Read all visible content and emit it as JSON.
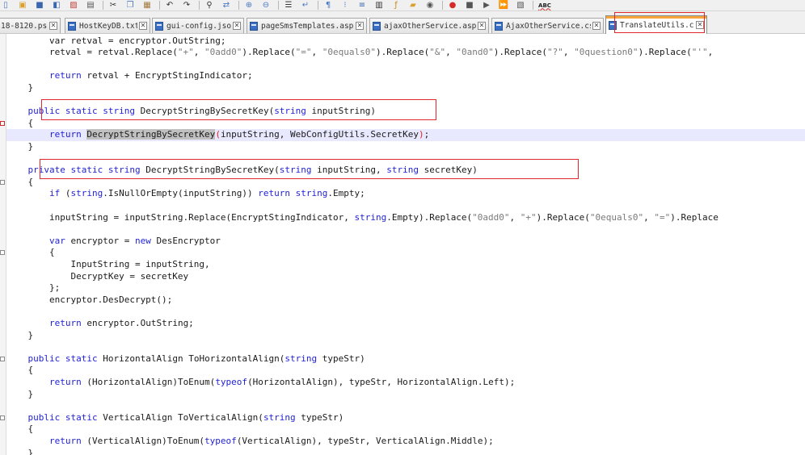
{
  "toolbar": {
    "icons": [
      "new-file-icon",
      "open-icon",
      "save-icon",
      "save-all-icon",
      "close-file-icon",
      "print-icon",
      "cut-icon",
      "copy-icon",
      "paste-icon",
      "undo-icon",
      "redo-icon",
      "find-icon",
      "replace-icon",
      "zoom-in-icon",
      "zoom-out-icon",
      "sync-scroll-icon",
      "word-wrap-icon",
      "show-all-chars-icon",
      "indent-guide-icon",
      "lang-icon",
      "doc-map-icon",
      "function-list-icon",
      "folder-workspace-icon",
      "monitor-icon",
      "record-macro-icon",
      "stop-macro-icon",
      "play-macro-icon",
      "run-macro-multiple-icon",
      "save-macro-icon",
      "spellcheck-icon"
    ],
    "spellcheck_label": "ABC"
  },
  "tabs": [
    {
      "label": "18-8120.ps1",
      "close": "✕"
    },
    {
      "label": "HostKeyDB.txt",
      "close": "✕"
    },
    {
      "label": "gui-config.json",
      "close": "✕"
    },
    {
      "label": "pageSmsTemplates.aspx",
      "close": "✕"
    },
    {
      "label": "ajaxOtherService.aspx",
      "close": "✕"
    },
    {
      "label": "AjaxOtherService.cs",
      "close": "✕"
    },
    {
      "label": "TranslateUtils.cs",
      "close": "✕",
      "active": true
    }
  ],
  "colors": {
    "keyword": "#1f1fd6",
    "string": "#7a7a7a",
    "annotation": "#e0282d",
    "active_tab_accent": "#f5a53c",
    "current_line": "#e8e8ff"
  },
  "code": [
    [
      {
        "t": "        var retval = encryptor.OutString;"
      }
    ],
    [
      {
        "t": "        retval = retval.Replace("
      },
      {
        "t": "\"+\"",
        "c": "str"
      },
      {
        "t": ", "
      },
      {
        "t": "\"0add0\"",
        "c": "str"
      },
      {
        "t": ").Replace("
      },
      {
        "t": "\"=\"",
        "c": "str"
      },
      {
        "t": ", "
      },
      {
        "t": "\"0equals0\"",
        "c": "str"
      },
      {
        "t": ").Replace("
      },
      {
        "t": "\"&\"",
        "c": "str"
      },
      {
        "t": ", "
      },
      {
        "t": "\"0and0\"",
        "c": "str"
      },
      {
        "t": ").Replace("
      },
      {
        "t": "\"?\"",
        "c": "str"
      },
      {
        "t": ", "
      },
      {
        "t": "\"0question0\"",
        "c": "str"
      },
      {
        "t": ").Replace("
      },
      {
        "t": "\"'\"",
        "c": "str"
      },
      {
        "t": ","
      }
    ],
    [
      {
        "t": ""
      }
    ],
    [
      {
        "t": "        "
      },
      {
        "t": "return",
        "c": "kw"
      },
      {
        "t": " retval + EncryptStingIndicator;"
      }
    ],
    [
      {
        "t": "    }"
      }
    ],
    [
      {
        "t": ""
      }
    ],
    [
      {
        "t": "    "
      },
      {
        "t": "public",
        "c": "kw"
      },
      {
        "t": " "
      },
      {
        "t": "static",
        "c": "kw"
      },
      {
        "t": " "
      },
      {
        "t": "string",
        "c": "kw"
      },
      {
        "t": " DecryptStringBySecretKey("
      },
      {
        "t": "string",
        "c": "kw"
      },
      {
        "t": " inputString)"
      }
    ],
    [
      {
        "t": "    {"
      }
    ],
    [
      {
        "t": "        "
      },
      {
        "t": "return",
        "c": "kw"
      },
      {
        "t": " "
      },
      {
        "t": "DecryptStringBySecretKey",
        "c": "ref"
      },
      {
        "t": "(",
        "c": "bracket"
      },
      {
        "t": "inputString, WebConfigUtils.SecretKey"
      },
      {
        "t": ")",
        "c": "bracket"
      },
      {
        "t": ";"
      }
    ],
    [
      {
        "t": "    }"
      }
    ],
    [
      {
        "t": ""
      }
    ],
    [
      {
        "t": "    "
      },
      {
        "t": "private",
        "c": "kw"
      },
      {
        "t": " "
      },
      {
        "t": "static",
        "c": "kw"
      },
      {
        "t": " "
      },
      {
        "t": "string",
        "c": "kw"
      },
      {
        "t": " DecryptStringBySecretKey("
      },
      {
        "t": "string",
        "c": "kw"
      },
      {
        "t": " inputString, "
      },
      {
        "t": "string",
        "c": "kw"
      },
      {
        "t": " secretKey)"
      }
    ],
    [
      {
        "t": "    {"
      }
    ],
    [
      {
        "t": "        "
      },
      {
        "t": "if",
        "c": "kw"
      },
      {
        "t": " ("
      },
      {
        "t": "string",
        "c": "kw"
      },
      {
        "t": ".IsNullOrEmpty(inputString)) "
      },
      {
        "t": "return",
        "c": "kw"
      },
      {
        "t": " "
      },
      {
        "t": "string",
        "c": "kw"
      },
      {
        "t": ".Empty;"
      }
    ],
    [
      {
        "t": ""
      }
    ],
    [
      {
        "t": "        inputString = inputString.Replace(EncryptStingIndicator, "
      },
      {
        "t": "string",
        "c": "kw"
      },
      {
        "t": ".Empty).Replace("
      },
      {
        "t": "\"0add0\"",
        "c": "str"
      },
      {
        "t": ", "
      },
      {
        "t": "\"+\"",
        "c": "str"
      },
      {
        "t": ").Replace("
      },
      {
        "t": "\"0equals0\"",
        "c": "str"
      },
      {
        "t": ", "
      },
      {
        "t": "\"=\"",
        "c": "str"
      },
      {
        "t": ").Replace"
      }
    ],
    [
      {
        "t": ""
      }
    ],
    [
      {
        "t": "        "
      },
      {
        "t": "var",
        "c": "kw"
      },
      {
        "t": " encryptor = "
      },
      {
        "t": "new",
        "c": "kw"
      },
      {
        "t": " DesEncryptor"
      }
    ],
    [
      {
        "t": "        {"
      }
    ],
    [
      {
        "t": "            InputString = inputString,"
      }
    ],
    [
      {
        "t": "            DecryptKey = secretKey"
      }
    ],
    [
      {
        "t": "        };"
      }
    ],
    [
      {
        "t": "        encryptor.DesDecrypt();"
      }
    ],
    [
      {
        "t": ""
      }
    ],
    [
      {
        "t": "        "
      },
      {
        "t": "return",
        "c": "kw"
      },
      {
        "t": " encryptor.OutString;"
      }
    ],
    [
      {
        "t": "    }"
      }
    ],
    [
      {
        "t": ""
      }
    ],
    [
      {
        "t": "    "
      },
      {
        "t": "public",
        "c": "kw"
      },
      {
        "t": " "
      },
      {
        "t": "static",
        "c": "kw"
      },
      {
        "t": " HorizontalAlign ToHorizontalAlign("
      },
      {
        "t": "string",
        "c": "kw"
      },
      {
        "t": " typeStr)"
      }
    ],
    [
      {
        "t": "    {"
      }
    ],
    [
      {
        "t": "        "
      },
      {
        "t": "return",
        "c": "kw"
      },
      {
        "t": " (HorizontalAlign)ToEnum("
      },
      {
        "t": "typeof",
        "c": "kw"
      },
      {
        "t": "(HorizontalAlign), typeStr, HorizontalAlign.Left);"
      }
    ],
    [
      {
        "t": "    }"
      }
    ],
    [
      {
        "t": ""
      }
    ],
    [
      {
        "t": "    "
      },
      {
        "t": "public",
        "c": "kw"
      },
      {
        "t": " "
      },
      {
        "t": "static",
        "c": "kw"
      },
      {
        "t": " VerticalAlign ToVerticalAlign("
      },
      {
        "t": "string",
        "c": "kw"
      },
      {
        "t": " typeStr)"
      }
    ],
    [
      {
        "t": "    {"
      }
    ],
    [
      {
        "t": "        "
      },
      {
        "t": "return",
        "c": "kw"
      },
      {
        "t": " (VerticalAlign)ToEnum("
      },
      {
        "t": "typeof",
        "c": "kw"
      },
      {
        "t": "(VerticalAlign), typeStr, VerticalAlign.Middle);"
      }
    ],
    [
      {
        "t": "    }"
      }
    ]
  ]
}
